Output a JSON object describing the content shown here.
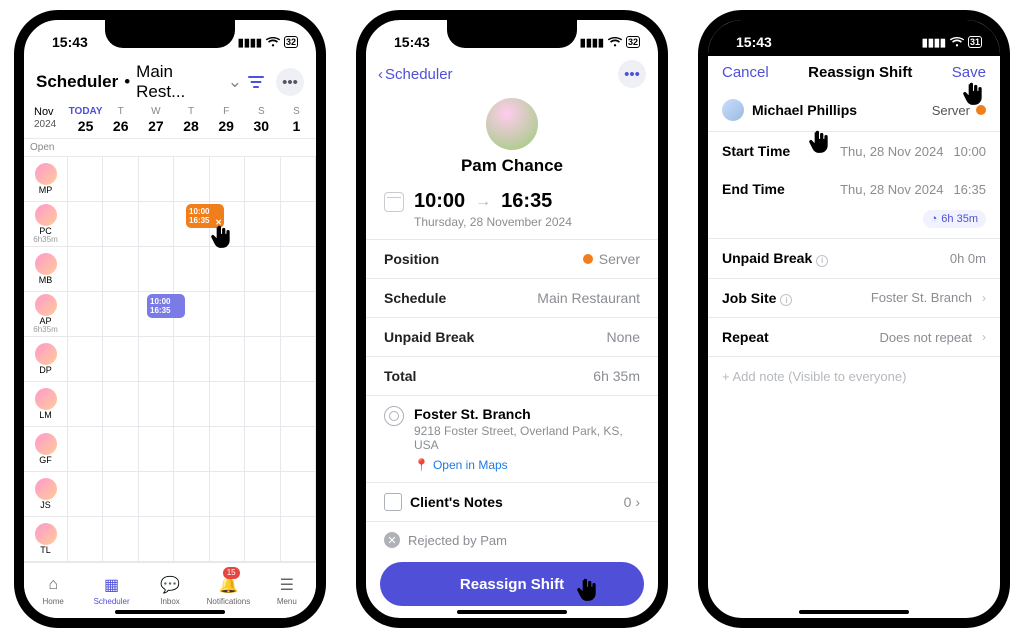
{
  "status_bar": {
    "time": "15:43",
    "battery": "32",
    "battery3": "31"
  },
  "phone1": {
    "title": "Scheduler",
    "location": "Main Rest...",
    "month": "Nov",
    "year": "2024",
    "days": [
      {
        "lbl": "TODAY",
        "num": "25",
        "today": true
      },
      {
        "lbl": "T",
        "num": "26"
      },
      {
        "lbl": "W",
        "num": "27"
      },
      {
        "lbl": "T",
        "num": "28"
      },
      {
        "lbl": "F",
        "num": "29"
      },
      {
        "lbl": "S",
        "num": "30"
      },
      {
        "lbl": "S",
        "num": "1"
      }
    ],
    "open_label": "Open",
    "employees": [
      {
        "code": "MP"
      },
      {
        "code": "PC",
        "sub": "6h35m"
      },
      {
        "code": "MB"
      },
      {
        "code": "AP",
        "sub": "6h35m"
      },
      {
        "code": "DP"
      },
      {
        "code": "LM"
      },
      {
        "code": "GF"
      },
      {
        "code": "JS"
      },
      {
        "code": "TL"
      }
    ],
    "chip_orange": {
      "t1": "10:00",
      "t2": "16:35"
    },
    "chip_purple": {
      "t1": "10:00",
      "t2": "16:35"
    },
    "tabs": {
      "home": "Home",
      "scheduler": "Scheduler",
      "inbox": "Inbox",
      "notifications": "Notifications",
      "menu": "Menu",
      "badge": "15"
    }
  },
  "phone2": {
    "back": "Scheduler",
    "name": "Pam Chance",
    "start": "10:00",
    "end": "16:35",
    "date": "Thursday, 28 November 2024",
    "rows": {
      "position_l": "Position",
      "position_r": "Server",
      "schedule_l": "Schedule",
      "schedule_r": "Main Restaurant",
      "break_l": "Unpaid Break",
      "break_r": "None",
      "total_l": "Total",
      "total_r": "6h 35m"
    },
    "loc_name": "Foster St. Branch",
    "loc_addr": "9218 Foster Street, Overland Park, KS, USA",
    "map_link": "Open in Maps",
    "notes_l": "Client's Notes",
    "notes_r": "0",
    "rejected": "Rejected by Pam",
    "cta": "Reassign Shift"
  },
  "phone3": {
    "cancel": "Cancel",
    "title": "Reassign Shift",
    "save": "Save",
    "emp_name": "Michael Phillips",
    "emp_role": "Server",
    "start_l": "Start Time",
    "start_d": "Thu, 28 Nov 2024",
    "start_t": "10:00",
    "end_l": "End Time",
    "end_d": "Thu, 28 Nov 2024",
    "end_t": "16:35",
    "duration": "6h 35m",
    "break_l": "Unpaid Break",
    "break_v": "0h 0m",
    "job_l": "Job Site",
    "job_v": "Foster St. Branch",
    "repeat_l": "Repeat",
    "repeat_v": "Does not repeat",
    "note_ph": "+ Add note (Visible to everyone)"
  }
}
